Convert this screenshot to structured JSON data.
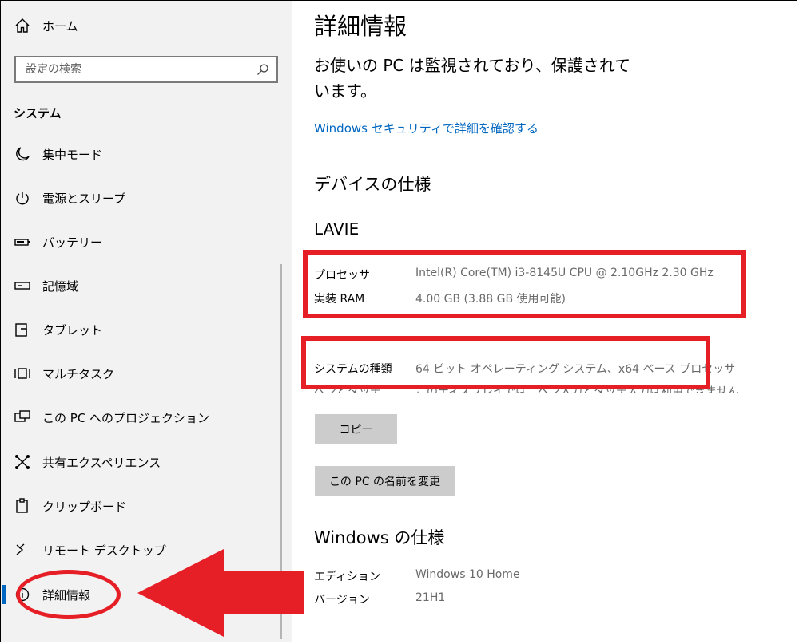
{
  "sidebar": {
    "home_label": "ホーム",
    "search_placeholder": "設定の検索",
    "section_title": "システム",
    "items": [
      {
        "label": "集中モード",
        "icon": "moon-icon"
      },
      {
        "label": "電源とスリープ",
        "icon": "power-icon"
      },
      {
        "label": "バッテリー",
        "icon": "battery-icon"
      },
      {
        "label": "記憶域",
        "icon": "storage-icon"
      },
      {
        "label": "タブレット",
        "icon": "tablet-icon"
      },
      {
        "label": "マルチタスク",
        "icon": "multitask-icon"
      },
      {
        "label": "この PC へのプロジェクション",
        "icon": "projection-icon"
      },
      {
        "label": "共有エクスペリエンス",
        "icon": "shared-experience-icon"
      },
      {
        "label": "クリップボード",
        "icon": "clipboard-icon"
      },
      {
        "label": "リモート デスクトップ",
        "icon": "remote-desktop-icon"
      },
      {
        "label": "詳細情報",
        "icon": "info-icon",
        "selected": true
      }
    ]
  },
  "main": {
    "title": "詳細情報",
    "protect_text": "お使いの PC は監視されており、保護されています。",
    "security_link": "Windows セキュリティで詳細を確認する",
    "device_spec_heading": "デバイスの仕様",
    "device_name": "LAVIE",
    "specs": [
      {
        "key": "プロセッサ",
        "value": "Intel(R) Core(TM) i3-8145U CPU @ 2.10GHz   2.30 GHz"
      },
      {
        "key": "実装 RAM",
        "value": "4.00 GB (3.88 GB 使用可能)"
      },
      {
        "key": "システムの種類",
        "value": "64 ビット オペレーティング システム、x64 ベース プロセッサ"
      }
    ],
    "pen_touch": {
      "key": "ペンとタッチ",
      "value": "このディスプレイでは、ペン入力とタッチ入力は利用できません"
    },
    "copy_button": "コピー",
    "rename_button": "この PC の名前を変更",
    "windows_spec_heading": "Windows の仕様",
    "windows_specs": [
      {
        "key": "エディション",
        "value": "Windows 10 Home"
      },
      {
        "key": "バージョン",
        "value": "21H1"
      }
    ]
  },
  "colors": {
    "accent": "#0067c0",
    "annotation": "#e61e25",
    "sidebar_bg": "#f2f2f2",
    "button_bg": "#cccccc"
  }
}
